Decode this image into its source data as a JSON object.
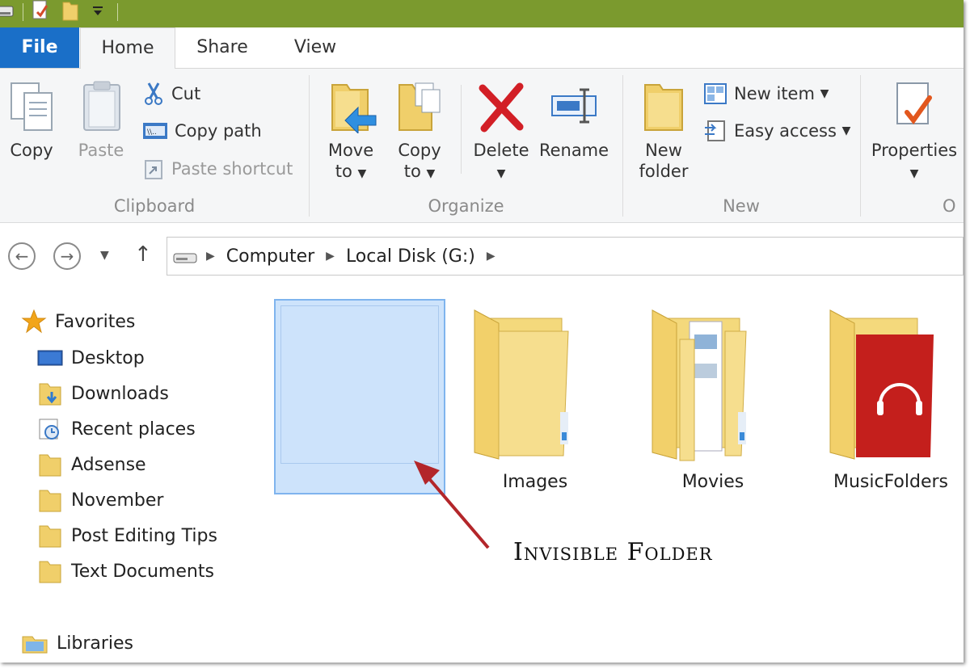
{
  "tabs": {
    "file": "File",
    "home": "Home",
    "share": "Share",
    "view": "View"
  },
  "ribbon": {
    "clipboard": {
      "label": "Clipboard",
      "copy": "Copy",
      "paste": "Paste",
      "cut": "Cut",
      "copy_path": "Copy path",
      "paste_shortcut": "Paste shortcut"
    },
    "organize": {
      "label": "Organize",
      "move_to": [
        "Move",
        "to"
      ],
      "copy_to": [
        "Copy",
        "to"
      ],
      "delete": "Delete",
      "rename": "Rename"
    },
    "new": {
      "label": "New",
      "new_folder": [
        "New",
        "folder"
      ],
      "new_item": "New item",
      "easy_access": "Easy access"
    },
    "open": {
      "label": "O",
      "properties": "Properties"
    }
  },
  "address": {
    "crumbs": [
      "Computer",
      "Local Disk (G:)"
    ]
  },
  "nav": {
    "favorites": "Favorites",
    "items": [
      "Desktop",
      "Downloads",
      "Recent places",
      "Adsense",
      "November",
      "Post Editing Tips",
      "Text Documents"
    ],
    "libraries": "Libraries"
  },
  "content": {
    "folders": [
      "Images",
      "Movies",
      "MusicFolders"
    ],
    "annotation": "Invisible Folder"
  },
  "colors": {
    "titlebar": "#7b9a2e",
    "file_tab": "#1a6fc8",
    "selection": "#cde3fb",
    "arrow": "#b3262a",
    "folder": "#f2d77a"
  }
}
